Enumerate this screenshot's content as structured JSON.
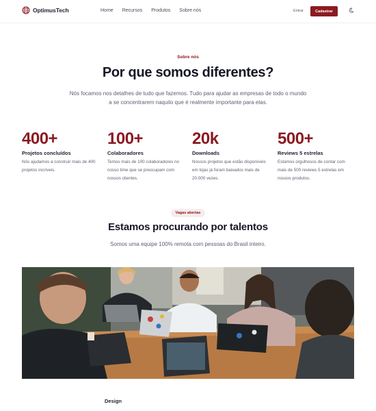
{
  "header": {
    "brand": "OptimusTech",
    "nav": [
      "Home",
      "Recursos",
      "Produtos",
      "Sobre nós"
    ],
    "login_label": "Entrar",
    "signup_label": "Cadastrar",
    "theme_icon": "moon-icon",
    "logo_icon": "globe-icon"
  },
  "about": {
    "eyebrow": "Sobre nós",
    "title": "Por que somos diferentes?",
    "lead": "Nós focamos nos detalhes de tudo que fazemos. Tudo para ajudar as empresas de todo o mundo a se concentrarem naquilo que é realmente importante para elas.",
    "stats": [
      {
        "value": "400+",
        "label": "Projetos concluídos",
        "desc": "Nós ajudamos a construir mais de 400 projetos incríveis."
      },
      {
        "value": "100+",
        "label": "Colaboradores",
        "desc": "Temos mais de 100 colaboradores no nosso time que se preocupam com nossos clientes."
      },
      {
        "value": "20k",
        "label": "Downloads",
        "desc": "Nossos projetos que estão disponíveis em lojas já foram baixados mais de 20.000 vezes."
      },
      {
        "value": "500+",
        "label": "Reviews 5 estrelas",
        "desc": "Estamos orgulhosos de contar com mais de 500 reviews 5 estrelas em nossos produtos."
      }
    ]
  },
  "careers": {
    "badge": "Vagas abertas",
    "title": "Estamos procurando por talentos",
    "subtitle": "Somos uma equipe 100% remota com pessoas do Brasil inteiro.",
    "first_department": "Design"
  },
  "colors": {
    "brand": "#8b1a22",
    "text": "#151726",
    "muted": "#5d6072"
  }
}
